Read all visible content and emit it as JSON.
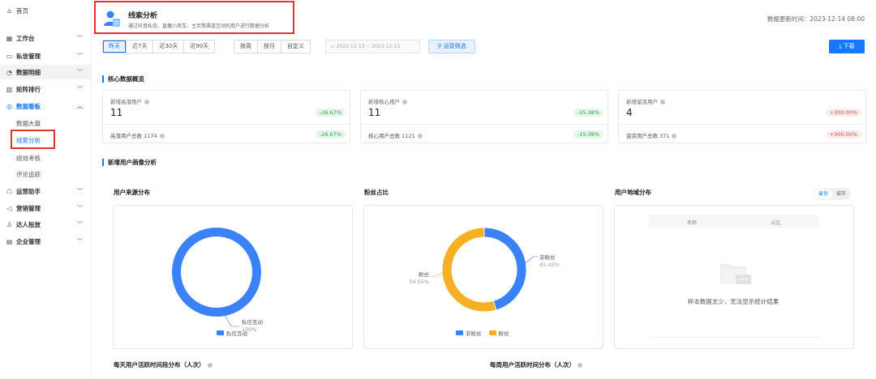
{
  "sidebar": {
    "home": "首页",
    "items": [
      {
        "label": "工作台",
        "icon": "grid-icon"
      },
      {
        "label": "私信管理",
        "icon": "message-icon"
      },
      {
        "label": "数据明细",
        "icon": "pie-icon"
      },
      {
        "label": "矩阵排行",
        "icon": "bar-icon"
      },
      {
        "label": "数据看板",
        "icon": "dashboard-icon"
      },
      {
        "label": "运营助手",
        "icon": "helper-icon"
      },
      {
        "label": "营销管理",
        "icon": "megaphone-icon"
      },
      {
        "label": "达人投放",
        "icon": "user-icon"
      },
      {
        "label": "企业管理",
        "icon": "building-icon"
      }
    ],
    "sub_items": [
      "数据大盘",
      "线索分析",
      "绩效考核",
      "评论追踪"
    ]
  },
  "header": {
    "title": "线索分析",
    "subtitle": "通过抖音私信、直播小风车、主页等渠道互动的用户进行数据分析",
    "update_time": "数据更新时间：2023-12-14 08:00"
  },
  "filters": {
    "quick": [
      "昨天",
      "近7天",
      "近30天",
      "近90天"
    ],
    "period": [
      "按周",
      "按月",
      "自定义"
    ],
    "date_range": "2023-12-13 ~ 2023-12-13",
    "advanced": "运营筛选",
    "download": "下载"
  },
  "core": {
    "section_title": "核心数据概览",
    "cards": [
      {
        "label": "新增高潜用户",
        "value": "11",
        "change": "-26.67%",
        "total": "高潜用户总数 1174",
        "total_change": "-26.67%",
        "trend": "down"
      },
      {
        "label": "新增核心用户",
        "value": "11",
        "change": "-15.38%",
        "total": "核心用户总数 1121",
        "total_change": "-15.38%",
        "trend": "down"
      },
      {
        "label": "新增留资用户",
        "value": "4",
        "change": "+300.00%",
        "total": "留资用户总数 371",
        "total_change": "+300.00%",
        "trend": "up"
      }
    ]
  },
  "portrait": {
    "section_title": "新增用户画像分析",
    "source": {
      "title": "用户来源分布",
      "slice_label": "私信互动",
      "slice_pct": "100%",
      "legend": "私信互动"
    },
    "fans": {
      "title": "粉丝占比",
      "non_fan_label": "非粉丝",
      "non_fan_pct": "45.45%",
      "fan_label": "粉丝",
      "fan_pct": "54.55%",
      "legend_non_fan": "非粉丝",
      "legend_fan": "粉丝"
    },
    "region": {
      "title": "用户地域分布",
      "toggle": [
        "省份",
        "城市"
      ],
      "col_name": "名称",
      "col_ratio": "占比",
      "empty": "样本数据太少，无法显示统计结果"
    }
  },
  "bottom": {
    "daily": "每天用户活跃时间段分布（人次）",
    "weekly": "每周用户活跃时间分布（人次）"
  },
  "chart_data": [
    {
      "type": "pie",
      "title": "用户来源分布",
      "categories": [
        "私信互动"
      ],
      "values": [
        100
      ],
      "unit": "%"
    },
    {
      "type": "pie",
      "title": "粉丝占比",
      "categories": [
        "非粉丝",
        "粉丝"
      ],
      "values": [
        45.45,
        54.55
      ],
      "unit": "%"
    }
  ],
  "colors": {
    "blue": "#3b82f6",
    "orange": "#f7b022",
    "accent": "#1677ff",
    "highlight": "#e0332c"
  }
}
